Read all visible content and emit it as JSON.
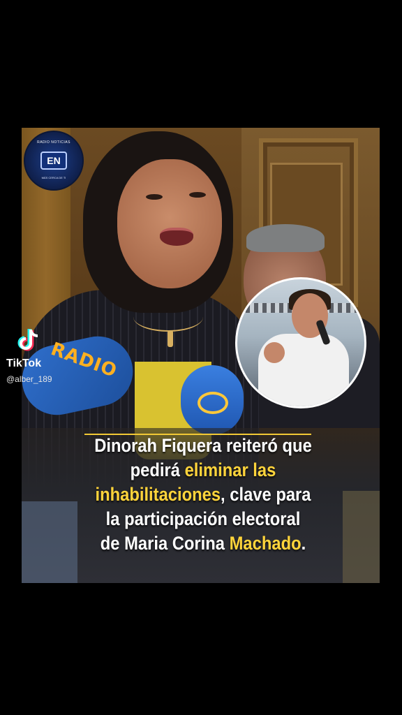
{
  "video": {
    "logo": {
      "top_text": "RADIO NOTICIAS",
      "mark": "EN",
      "bottom_text": "MÁS CERCA DE TI"
    },
    "mic_brand": "RADIO",
    "caption": {
      "parts": [
        {
          "text": "Dinorah Fiquera reiteró que",
          "highlight": false
        },
        {
          "text": "pedirá ",
          "highlight": false
        },
        {
          "text": "eliminar las",
          "highlight": true
        },
        {
          "text": "inhabilitaciones",
          "highlight": true
        },
        {
          "text": ", clave para",
          "highlight": false
        },
        {
          "text": "la participación electoral",
          "highlight": false
        },
        {
          "text": "de Maria Corina ",
          "highlight": false
        },
        {
          "text": "Machado",
          "highlight": true
        },
        {
          "text": ".",
          "highlight": false
        }
      ]
    },
    "colors": {
      "highlight": "#ffd43b",
      "caption_rule": "#f2c935"
    }
  },
  "tiktok": {
    "icon": "tiktok-logo-icon",
    "name": "TikTok",
    "username": "@alber_189"
  }
}
